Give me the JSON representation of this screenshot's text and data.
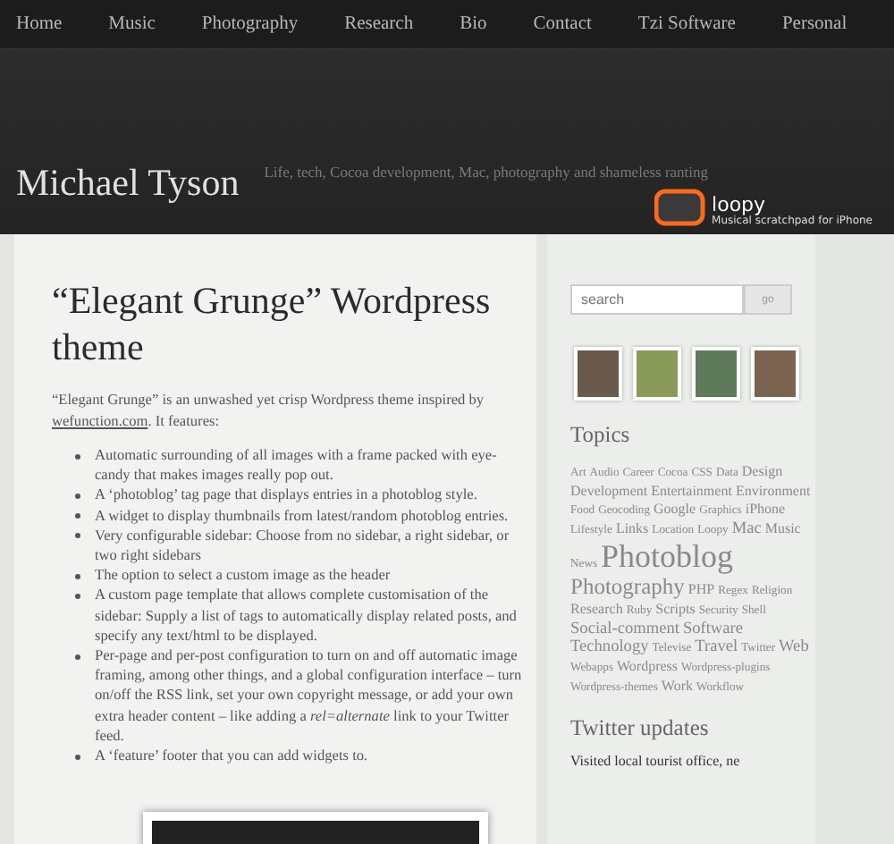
{
  "nav": [
    {
      "label": "Home"
    },
    {
      "label": "Music"
    },
    {
      "label": "Photography"
    },
    {
      "label": "Research"
    },
    {
      "label": "Bio"
    },
    {
      "label": "Contact"
    },
    {
      "label": "Tzi Software"
    },
    {
      "label": "Personal"
    }
  ],
  "header": {
    "site_title": "Michael Tyson",
    "tagline": "Life, tech, Cocoa development, Mac, photography and shameless ranting",
    "promo": {
      "name": "loopy",
      "caption": "Musical scratchpad for iPhone"
    }
  },
  "post": {
    "title": "“Elegant Grunge” Wordpress theme",
    "intro_before": "“Elegant Grunge” is an unwashed yet crisp Wordpress theme inspired by ",
    "intro_link": "wefunction.com",
    "intro_after": ". It features:",
    "features": [
      "Automatic surrounding of all images with a frame packed with eye-candy that makes images really pop out.",
      "A ‘photoblog’ tag page that displays entries in a photoblog style.",
      "A widget to display thumbnails from latest/random photoblog entries.",
      "Very configurable sidebar: Choose from no sidebar, a right sidebar, or two right sidebars",
      "The option to select a custom image as the header",
      "A custom page template that allows complete customisation of the sidebar: Supply a list of tags to automatically display related posts, and specify any text/html to be displayed.",
      "Per-page and per-post configuration to turn on and off automatic image framing, among other things, and a global configuration interface – turn on/off the RSS link, set your own copyright message, or add your own extra header content – like adding a *rel=alternate* link to your Twitter feed.",
      "A ‘feature’ footer that you can add widgets to."
    ]
  },
  "sidebar": {
    "search": {
      "placeholder": "search",
      "button": "go"
    },
    "topics_title": "Topics",
    "tags": [
      {
        "label": "Art",
        "kind": "s"
      },
      {
        "label": "Audio",
        "kind": "s"
      },
      {
        "label": "Career",
        "kind": "s"
      },
      {
        "label": "Cocoa",
        "kind": "s"
      },
      {
        "label": "CSS",
        "kind": "s"
      },
      {
        "label": "Data",
        "kind": "s"
      },
      {
        "label": "Design",
        "kind": "m"
      },
      {
        "label": "Development",
        "kind": "m"
      },
      {
        "label": "Entertainment",
        "kind": "m"
      },
      {
        "label": "Environment",
        "kind": "m"
      },
      {
        "label": "Food",
        "kind": "s"
      },
      {
        "label": "Geocoding",
        "kind": "s"
      },
      {
        "label": "Google",
        "kind": "m"
      },
      {
        "label": "Graphics",
        "kind": "s"
      },
      {
        "label": "iPhone",
        "kind": "m"
      },
      {
        "label": "Lifestyle",
        "kind": "s"
      },
      {
        "label": "Links",
        "kind": "m"
      },
      {
        "label": "Location",
        "kind": "s"
      },
      {
        "label": "Loopy",
        "kind": "s"
      },
      {
        "label": "Mac",
        "kind": "l"
      },
      {
        "label": "Music",
        "kind": "m"
      },
      {
        "label": "News",
        "kind": "s"
      },
      {
        "label": "Photoblog",
        "kind": "xxl"
      },
      {
        "label": "Photography",
        "kind": "xl"
      },
      {
        "label": "PHP",
        "kind": "m"
      },
      {
        "label": "Regex",
        "kind": "s"
      },
      {
        "label": "Religion",
        "kind": "s"
      },
      {
        "label": "Research",
        "kind": "m"
      },
      {
        "label": "Ruby",
        "kind": "s"
      },
      {
        "label": "Scripts",
        "kind": "m"
      },
      {
        "label": "Security",
        "kind": "s"
      },
      {
        "label": "Shell",
        "kind": "s"
      },
      {
        "label": "Social-comment",
        "kind": "l"
      },
      {
        "label": "Software",
        "kind": "l"
      },
      {
        "label": "Technology",
        "kind": "l"
      },
      {
        "label": "Televise",
        "kind": "s"
      },
      {
        "label": "Travel",
        "kind": "l"
      },
      {
        "label": "Twitter",
        "kind": "s"
      },
      {
        "label": "Web",
        "kind": "l"
      },
      {
        "label": "Webapps",
        "kind": "s"
      },
      {
        "label": "Wordpress",
        "kind": "m"
      },
      {
        "label": "Wordpress-plugins",
        "kind": "s"
      },
      {
        "label": "Wordpress-themes",
        "kind": "s"
      },
      {
        "label": "Work",
        "kind": "m"
      },
      {
        "label": "Workflow",
        "kind": "s"
      }
    ],
    "twitter_title": "Twitter updates",
    "tweet": "Visited local tourist office, ne"
  }
}
